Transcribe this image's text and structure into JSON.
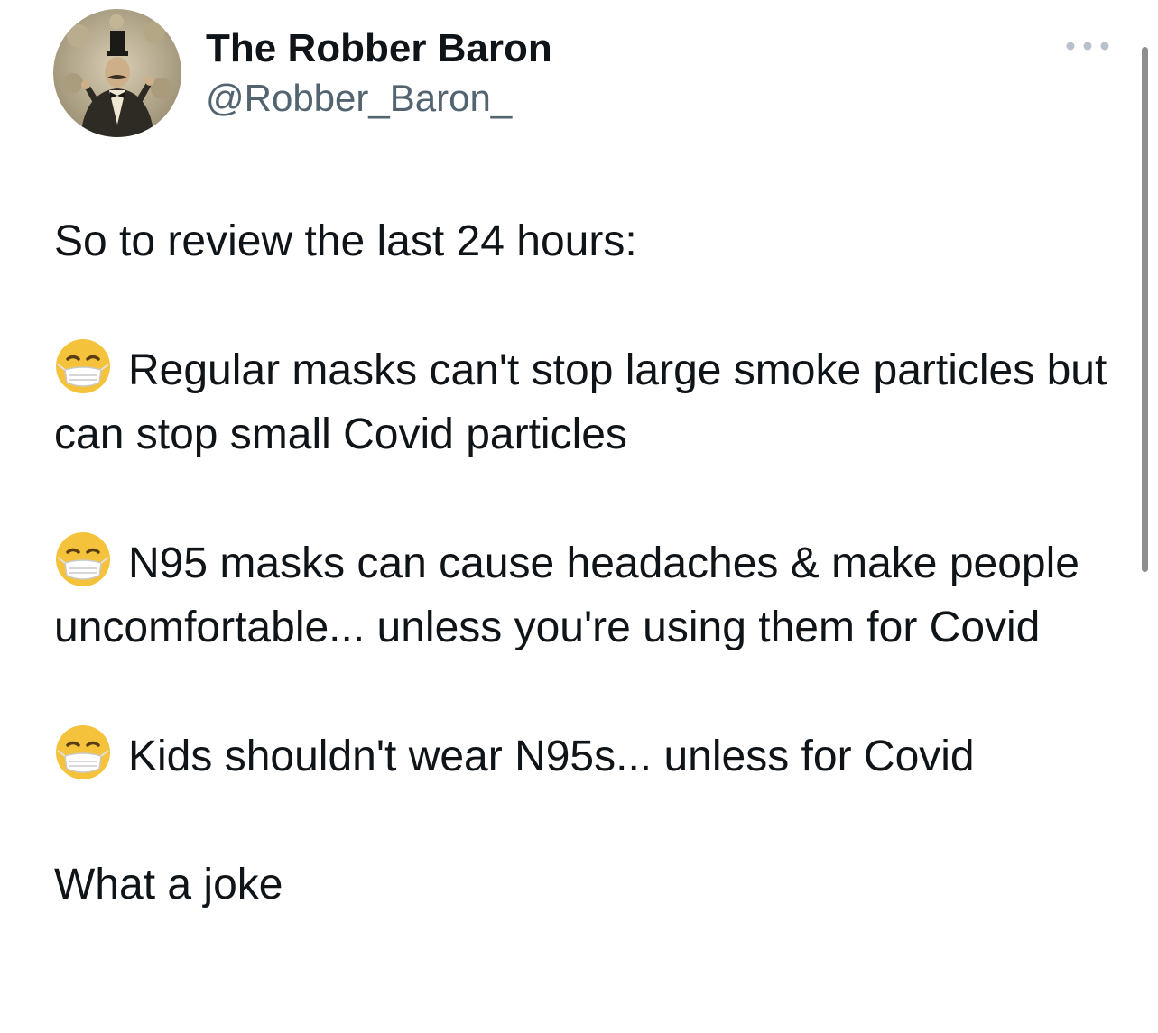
{
  "tweet": {
    "author": {
      "display_name": "The Robber Baron",
      "handle": "@Robber_Baron_"
    },
    "more_icon": "more-horizontal-icon",
    "paragraphs": [
      {
        "emoji": null,
        "text": "So to review the last 24 hours:"
      },
      {
        "emoji": "face-with-medical-mask-icon",
        "text": "Regular masks can't stop large smoke particles but can stop small Covid particles"
      },
      {
        "emoji": "face-with-medical-mask-icon",
        "text": "N95 masks can cause headaches & make people uncomfortable... unless you're using them for Covid"
      },
      {
        "emoji": "face-with-medical-mask-icon",
        "text": "Kids shouldn't wear N95s... unless for Covid"
      },
      {
        "emoji": null,
        "text": "What a joke"
      }
    ]
  },
  "colors": {
    "text_primary": "#0f1419",
    "text_secondary": "#536471",
    "emoji_face": "#f5c33b"
  }
}
